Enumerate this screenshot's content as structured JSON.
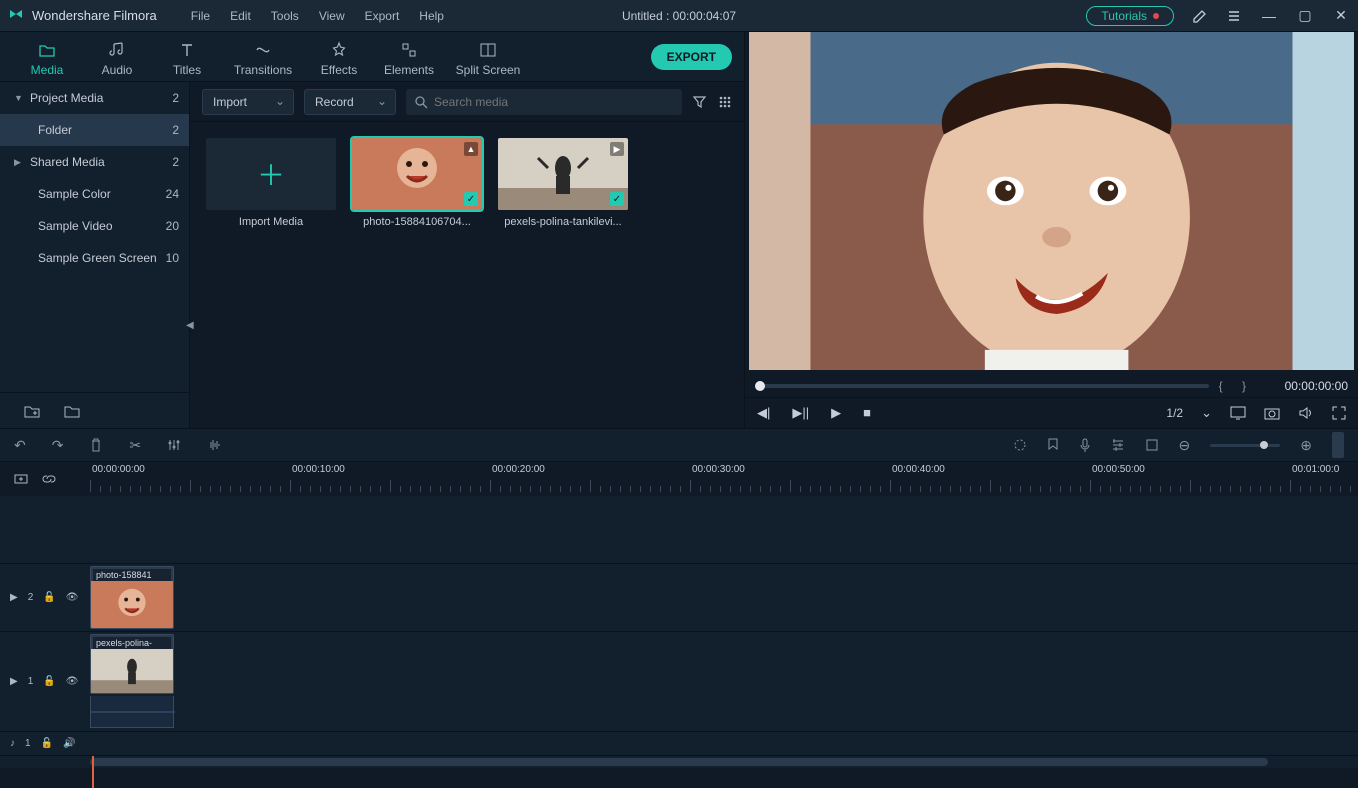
{
  "app_name": "Wondershare Filmora",
  "menu": [
    "File",
    "Edit",
    "Tools",
    "View",
    "Export",
    "Help"
  ],
  "document_title": "Untitled : 00:00:04:07",
  "tutorials_label": "Tutorials",
  "tabs": [
    {
      "label": "Media",
      "active": true
    },
    {
      "label": "Audio",
      "active": false
    },
    {
      "label": "Titles",
      "active": false
    },
    {
      "label": "Transitions",
      "active": false
    },
    {
      "label": "Effects",
      "active": false
    },
    {
      "label": "Elements",
      "active": false
    },
    {
      "label": "Split Screen",
      "active": false
    }
  ],
  "export_label": "EXPORT",
  "sidebar": {
    "items": [
      {
        "label": "Project Media",
        "count": "2",
        "caret": "▼",
        "selected": false,
        "indent": false
      },
      {
        "label": "Folder",
        "count": "2",
        "caret": "",
        "selected": true,
        "indent": true
      },
      {
        "label": "Shared Media",
        "count": "2",
        "caret": "▶",
        "selected": false,
        "indent": false
      },
      {
        "label": "Sample Color",
        "count": "24",
        "caret": "",
        "selected": false,
        "indent": true
      },
      {
        "label": "Sample Video",
        "count": "20",
        "caret": "",
        "selected": false,
        "indent": true
      },
      {
        "label": "Sample Green Screen",
        "count": "10",
        "caret": "",
        "selected": false,
        "indent": true
      }
    ]
  },
  "toolbar": {
    "import_label": "Import",
    "record_label": "Record",
    "search_placeholder": "Search media"
  },
  "media_tiles": {
    "import_caption": "Import Media",
    "tile1_caption": "photo-15884106704...",
    "tile2_caption": "pexels-polina-tankilevi..."
  },
  "preview": {
    "timecode": "00:00:00:00",
    "page_indicator": "1/2"
  },
  "ruler_marks": [
    "00:00:00:00",
    "00:00:10:00",
    "00:00:20:00",
    "00:00:30:00",
    "00:00:40:00",
    "00:00:50:00",
    "00:01:00:0"
  ],
  "timeline": {
    "track2_label": "2",
    "track1_label": "1",
    "audio_label": "1",
    "clip1_label": "photo-158841",
    "clip2_label": "pexels-polina-"
  },
  "colors": {
    "accent": "#23c9b0",
    "playhead": "#e2613e"
  }
}
